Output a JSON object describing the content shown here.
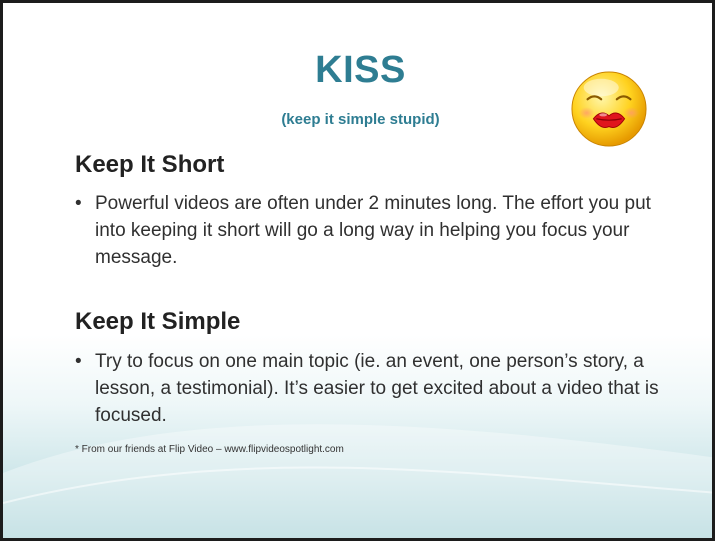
{
  "slide": {
    "title": "KISS",
    "subtitle": "(keep it simple stupid)",
    "sections": [
      {
        "heading": "Keep It Short",
        "bullet": "Powerful videos are often under 2 minutes long. The effort you put into keeping it short will go a long way in helping you focus your message."
      },
      {
        "heading": "Keep It Simple",
        "bullet": "Try to focus on one main topic (ie. an event, one person’s story, a lesson, a testimonial). It’s easier to get excited about a video that is focused."
      }
    ],
    "bullet_char": "•",
    "footnote": "* From our friends at Flip Video – www.flipvideospotlight.com"
  },
  "icons": {
    "emoji": "kissing-face-icon"
  },
  "colors": {
    "title": "#2e7d92",
    "background_bottom": "#a9d3d8"
  }
}
